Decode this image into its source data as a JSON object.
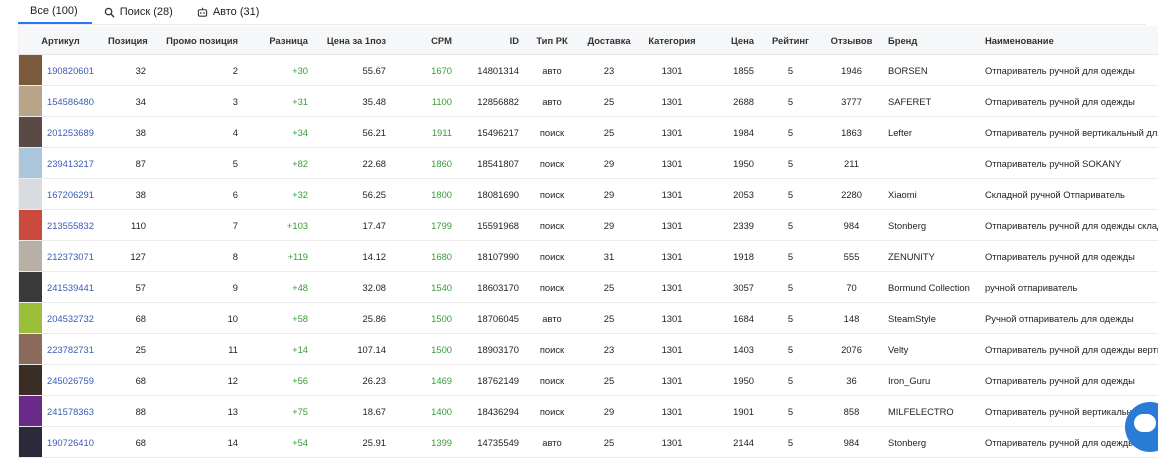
{
  "tabs": [
    {
      "label": "Все (100)",
      "icon": "none",
      "active": true
    },
    {
      "label": "Поиск (28)",
      "icon": "search-icon",
      "active": false
    },
    {
      "label": "Авто (31)",
      "icon": "robot-icon",
      "active": false
    }
  ],
  "columns": [
    "Артикул",
    "Позиция",
    "Промо позиция",
    "Разница",
    "Цена за 1поз",
    "CPM",
    "ID",
    "Тип РК",
    "Доставка",
    "Категория",
    "Цена",
    "Рейтинг",
    "Отзывов",
    "Бренд",
    "Наименование"
  ],
  "colors": {
    "link": "#3b5bb5",
    "positive": "#3a9a3a",
    "accent": "#2a73ff",
    "chat": "#2a7bd6"
  },
  "rows": [
    {
      "article": "190820601",
      "position": "32",
      "promo": "2",
      "diff": "+30",
      "price_per_pos": "55.67",
      "cpm": "1670",
      "id": "14801314",
      "type": "авто",
      "delivery": "23",
      "category": "1301",
      "price": "1855",
      "rating": "5",
      "reviews": "1946",
      "brand": "BORSEN",
      "name": "Отпариватель ручной для одежды",
      "thumb": "#7a5a3a"
    },
    {
      "article": "154586480",
      "position": "34",
      "promo": "3",
      "diff": "+31",
      "price_per_pos": "35.48",
      "cpm": "1100",
      "id": "12856882",
      "type": "авто",
      "delivery": "25",
      "category": "1301",
      "price": "2688",
      "rating": "5",
      "reviews": "3777",
      "brand": "SAFERET",
      "name": "Отпариватель ручной для одежды",
      "thumb": "#b9a48a"
    },
    {
      "article": "201253689",
      "position": "38",
      "promo": "4",
      "diff": "+34",
      "price_per_pos": "56.21",
      "cpm": "1911",
      "id": "15496217",
      "type": "поиск",
      "delivery": "25",
      "category": "1301",
      "price": "1984",
      "rating": "5",
      "reviews": "1863",
      "brand": "Lefter",
      "name": "Отпариватель ручной вертикальный для одежды",
      "thumb": "#5a4a46"
    },
    {
      "article": "239413217",
      "position": "87",
      "promo": "5",
      "diff": "+82",
      "price_per_pos": "22.68",
      "cpm": "1860",
      "id": "18541807",
      "type": "поиск",
      "delivery": "29",
      "category": "1301",
      "price": "1950",
      "rating": "5",
      "reviews": "211",
      "brand": "",
      "name": "Отпариватель ручной SOKANY",
      "thumb": "#aac6dc"
    },
    {
      "article": "167206291",
      "position": "38",
      "promo": "6",
      "diff": "+32",
      "price_per_pos": "56.25",
      "cpm": "1800",
      "id": "18081690",
      "type": "поиск",
      "delivery": "29",
      "category": "1301",
      "price": "2053",
      "rating": "5",
      "reviews": "2280",
      "brand": "Xiaomi",
      "name": "Складной ручной Отпариватель",
      "thumb": "#d8dce0"
    },
    {
      "article": "213555832",
      "position": "110",
      "promo": "7",
      "diff": "+103",
      "price_per_pos": "17.47",
      "cpm": "1799",
      "id": "15591968",
      "type": "поиск",
      "delivery": "29",
      "category": "1301",
      "price": "2339",
      "rating": "5",
      "reviews": "984",
      "brand": "Stonberg",
      "name": "Отпариватель ручной для одежды складной",
      "thumb": "#c94a3c"
    },
    {
      "article": "212373071",
      "position": "127",
      "promo": "8",
      "diff": "+119",
      "price_per_pos": "14.12",
      "cpm": "1680",
      "id": "18107990",
      "type": "поиск",
      "delivery": "31",
      "category": "1301",
      "price": "1918",
      "rating": "5",
      "reviews": "555",
      "brand": "ZENUNITY",
      "name": "Отпариватель ручной для одежды",
      "thumb": "#b8b0a4"
    },
    {
      "article": "241539441",
      "position": "57",
      "promo": "9",
      "diff": "+48",
      "price_per_pos": "32.08",
      "cpm": "1540",
      "id": "18603170",
      "type": "поиск",
      "delivery": "25",
      "category": "1301",
      "price": "3057",
      "rating": "5",
      "reviews": "70",
      "brand": "Bormund Collection",
      "name": "ручной отпариватель",
      "thumb": "#3a3a3a"
    },
    {
      "article": "204532732",
      "position": "68",
      "promo": "10",
      "diff": "+58",
      "price_per_pos": "25.86",
      "cpm": "1500",
      "id": "18706045",
      "type": "авто",
      "delivery": "25",
      "category": "1301",
      "price": "1684",
      "rating": "5",
      "reviews": "148",
      "brand": "SteamStyle",
      "name": "Ручной отпариватель для одежды",
      "thumb": "#9bbf3a"
    },
    {
      "article": "223782731",
      "position": "25",
      "promo": "11",
      "diff": "+14",
      "price_per_pos": "107.14",
      "cpm": "1500",
      "id": "18903170",
      "type": "поиск",
      "delivery": "23",
      "category": "1301",
      "price": "1403",
      "rating": "5",
      "reviews": "2076",
      "brand": "Velty",
      "name": "Отпариватель ручной для одежды вертикальный",
      "thumb": "#8a6a5a"
    },
    {
      "article": "245026759",
      "position": "68",
      "promo": "12",
      "diff": "+56",
      "price_per_pos": "26.23",
      "cpm": "1469",
      "id": "18762149",
      "type": "поиск",
      "delivery": "25",
      "category": "1301",
      "price": "1950",
      "rating": "5",
      "reviews": "36",
      "brand": "Iron_Guru",
      "name": "Отпариватель ручной для одежды",
      "thumb": "#3a2e24"
    },
    {
      "article": "241578363",
      "position": "88",
      "promo": "13",
      "diff": "+75",
      "price_per_pos": "18.67",
      "cpm": "1400",
      "id": "18436294",
      "type": "поиск",
      "delivery": "29",
      "category": "1301",
      "price": "1901",
      "rating": "5",
      "reviews": "858",
      "brand": "MILFELECTRO",
      "name": "Отпариватель ручной вертикальный для одежды",
      "thumb": "#6a2a8a"
    },
    {
      "article": "190726410",
      "position": "68",
      "promo": "14",
      "diff": "+54",
      "price_per_pos": "25.91",
      "cpm": "1399",
      "id": "14735549",
      "type": "авто",
      "delivery": "25",
      "category": "1301",
      "price": "2144",
      "rating": "5",
      "reviews": "984",
      "brand": "Stonberg",
      "name": "Отпариватель ручной для одежды",
      "thumb": "#2a2a3a"
    }
  ]
}
